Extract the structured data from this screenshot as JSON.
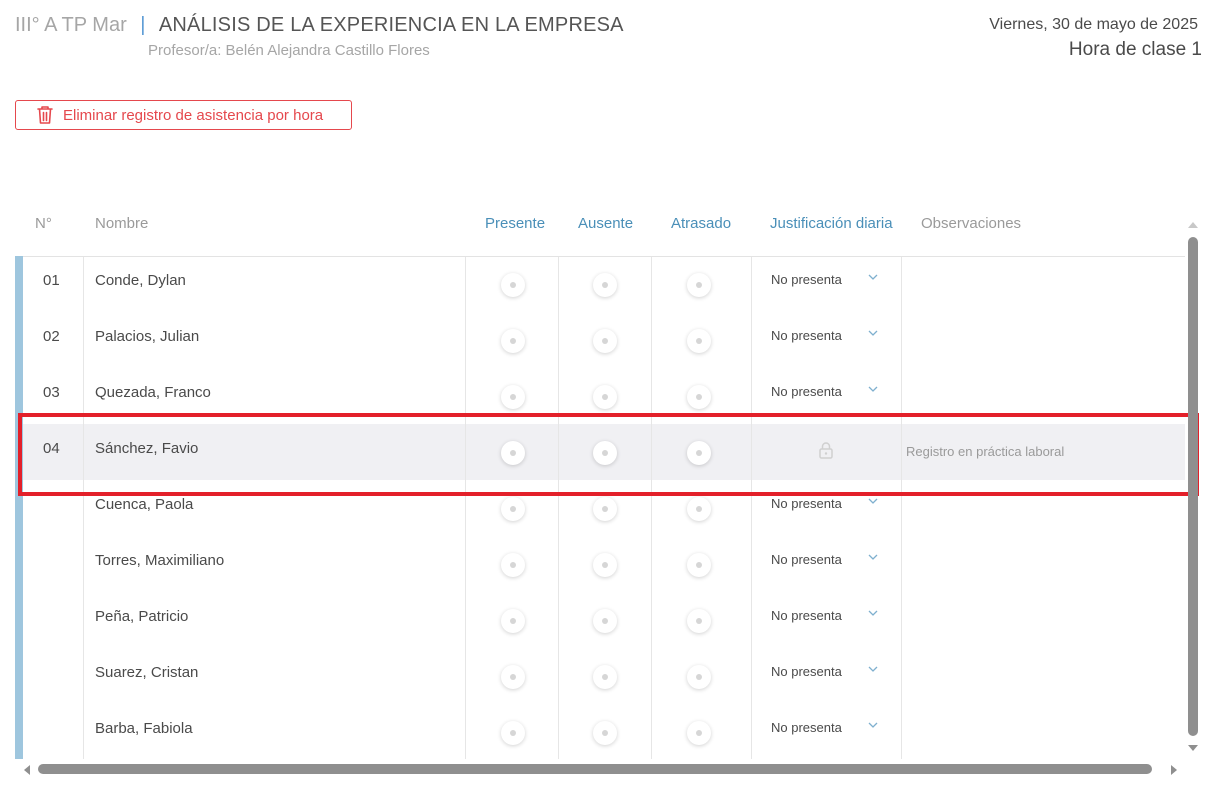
{
  "header": {
    "course": "III° A TP Mar",
    "separator": "|",
    "subject": "ANÁLISIS DE LA EXPERIENCIA EN LA EMPRESA",
    "teacher": "Profesor/a: Belén Alejandra Castillo Flores",
    "date": "Viernes, 30 de mayo de 2025",
    "hour": "Hora de clase 1"
  },
  "actions": {
    "delete_label": "Eliminar registro de asistencia por hora",
    "delete_icon": "trash-icon"
  },
  "columns": {
    "num": "N°",
    "name": "Nombre",
    "present": "Presente",
    "absent": "Ausente",
    "late": "Atrasado",
    "justification": "Justificación diaria",
    "observations": "Observaciones"
  },
  "rows": [
    {
      "num": "01",
      "name": "Conde, Dylan",
      "justification": "No presenta",
      "observation": "",
      "locked": false
    },
    {
      "num": "02",
      "name": "Palacios, Julian",
      "justification": "No presenta",
      "observation": "",
      "locked": false
    },
    {
      "num": "03",
      "name": "Quezada, Franco",
      "justification": "No presenta",
      "observation": "",
      "locked": false
    },
    {
      "num": "04",
      "name": "Sánchez, Favio",
      "justification": "",
      "observation": "Registro en práctica laboral",
      "locked": true
    },
    {
      "num": "",
      "name": "Cuenca, Paola",
      "justification": "No presenta",
      "observation": "",
      "locked": false
    },
    {
      "num": "",
      "name": "Torres, Maximiliano",
      "justification": "No presenta",
      "observation": "",
      "locked": false
    },
    {
      "num": "",
      "name": "Peña, Patricio",
      "justification": "No presenta",
      "observation": "",
      "locked": false
    },
    {
      "num": "",
      "name": "Suarez, Cristan",
      "justification": "No presenta",
      "observation": "",
      "locked": false
    },
    {
      "num": "",
      "name": "Barba, Fabiola",
      "justification": "No presenta",
      "observation": "",
      "locked": false
    }
  ],
  "colors": {
    "accent": "#4a8fb8",
    "danger": "#e5484d",
    "selection": "#e3202a",
    "row_marker": "#9ec6de"
  }
}
